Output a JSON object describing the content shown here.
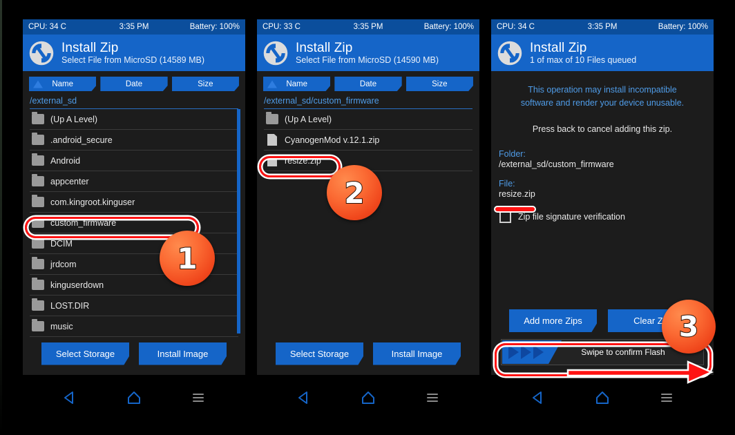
{
  "panels": [
    {
      "status": {
        "cpu": "CPU: 34 C",
        "time": "3:35 PM",
        "battery": "Battery: 100%"
      },
      "title": "Install Zip",
      "subtitle": "Select File from MicroSD (14589 MB)",
      "sort": {
        "name": "Name",
        "date": "Date",
        "size": "Size"
      },
      "path": "/external_sd",
      "files": [
        {
          "name": "(Up A Level)",
          "type": "folder"
        },
        {
          "name": ".android_secure",
          "type": "folder"
        },
        {
          "name": "Android",
          "type": "folder"
        },
        {
          "name": "appcenter",
          "type": "folder"
        },
        {
          "name": "com.kingroot.kinguser",
          "type": "folder"
        },
        {
          "name": "custom_firmware",
          "type": "folder"
        },
        {
          "name": "DCIM",
          "type": "folder"
        },
        {
          "name": "jrdcom",
          "type": "folder"
        },
        {
          "name": "kinguserdown",
          "type": "folder"
        },
        {
          "name": "LOST.DIR",
          "type": "folder"
        },
        {
          "name": "music",
          "type": "folder"
        }
      ],
      "buttons": {
        "left": "Select Storage",
        "right": "Install Image"
      }
    },
    {
      "status": {
        "cpu": "CPU: 33 C",
        "time": "3:35 PM",
        "battery": "Battery: 100%"
      },
      "title": "Install Zip",
      "subtitle": "Select File from MicroSD (14590 MB)",
      "sort": {
        "name": "Name",
        "date": "Date",
        "size": "Size"
      },
      "path": "/external_sd/custom_firmware",
      "files": [
        {
          "name": "(Up A Level)",
          "type": "folder"
        },
        {
          "name": "CyanogenMod v.12.1.zip",
          "type": "file"
        },
        {
          "name": "resize.zip",
          "type": "file"
        }
      ],
      "buttons": {
        "left": "Select Storage",
        "right": "Install Image"
      }
    },
    {
      "status": {
        "cpu": "CPU: 34 C",
        "time": "3:35 PM",
        "battery": "Battery: 100%"
      },
      "title": "Install Zip",
      "subtitle": "1 of max of 10 Files queued",
      "warning_line1": "This operation may install incompatible",
      "warning_line2": "software and render your device unusable.",
      "press_back": "Press back to cancel adding this zip.",
      "folder_label": "Folder:",
      "folder_value": "/external_sd/custom_firmware",
      "file_label": "File:",
      "file_value": "resize.zip",
      "checkbox_label": "Zip file signature verification",
      "checkbox_checked": false,
      "action_left": "Add more Zips",
      "action_right": "Clear Zip",
      "swipe_label": "Swipe to confirm Flash"
    }
  ],
  "nav": {
    "back_icon": "back-triangle-icon",
    "home_icon": "home-pentagon-icon",
    "menu_icon": "hamburger-menu-icon"
  },
  "annotations": {
    "step1": "1",
    "step2": "2",
    "step3": "3"
  },
  "colors": {
    "accent_blue": "#1565c8",
    "status_blue": "#0b4e9c",
    "link_blue": "#4f9ce8",
    "panel_bg": "#1c1c1c",
    "annotation_red": "#ff1313",
    "badge_orange": "#f0471c"
  }
}
